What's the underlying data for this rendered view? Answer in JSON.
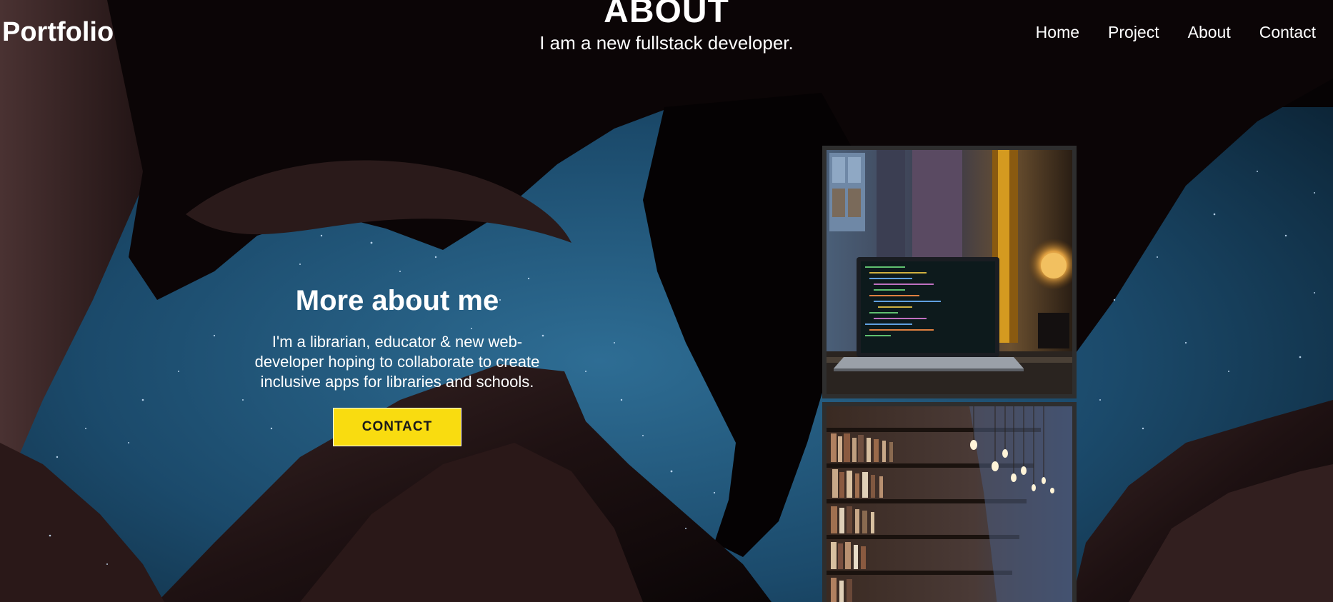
{
  "header": {
    "brand": "Portfolio",
    "title": "ABOUT",
    "subtitle": "I am a new fullstack developer.",
    "nav": [
      "Home",
      "Project",
      "About",
      "Contact"
    ]
  },
  "about": {
    "heading": "More about me",
    "body": "I'm a librarian, educator & new web-developer hoping to collaborate to create inclusive apps for libraries and schools.",
    "button_label": "CONTACT"
  },
  "colors": {
    "accent": "#f9dc10",
    "text": "#ffffff",
    "background": "#060304",
    "photo_frame": "#2e2e2e"
  },
  "images": {
    "background": "starry-night-canyon",
    "photo_top": "laptop-with-code-by-window",
    "photo_bottom": "library-bookshelves-with-hanging-bulbs"
  }
}
